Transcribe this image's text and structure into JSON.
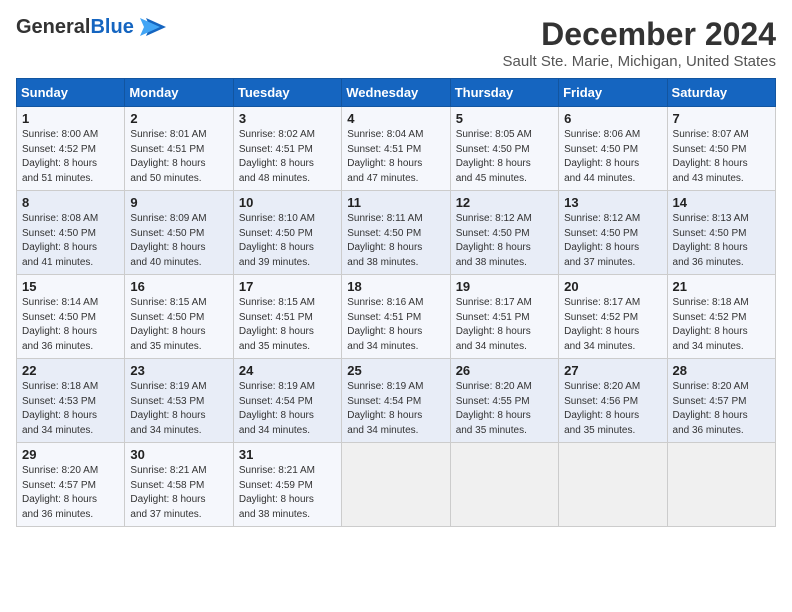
{
  "header": {
    "logo_line1": "General",
    "logo_line2": "Blue",
    "title": "December 2024",
    "subtitle": "Sault Ste. Marie, Michigan, United States"
  },
  "calendar": {
    "weekdays": [
      "Sunday",
      "Monday",
      "Tuesday",
      "Wednesday",
      "Thursday",
      "Friday",
      "Saturday"
    ],
    "weeks": [
      [
        {
          "day": "1",
          "info": "Sunrise: 8:00 AM\nSunset: 4:52 PM\nDaylight: 8 hours\nand 51 minutes."
        },
        {
          "day": "2",
          "info": "Sunrise: 8:01 AM\nSunset: 4:51 PM\nDaylight: 8 hours\nand 50 minutes."
        },
        {
          "day": "3",
          "info": "Sunrise: 8:02 AM\nSunset: 4:51 PM\nDaylight: 8 hours\nand 48 minutes."
        },
        {
          "day": "4",
          "info": "Sunrise: 8:04 AM\nSunset: 4:51 PM\nDaylight: 8 hours\nand 47 minutes."
        },
        {
          "day": "5",
          "info": "Sunrise: 8:05 AM\nSunset: 4:50 PM\nDaylight: 8 hours\nand 45 minutes."
        },
        {
          "day": "6",
          "info": "Sunrise: 8:06 AM\nSunset: 4:50 PM\nDaylight: 8 hours\nand 44 minutes."
        },
        {
          "day": "7",
          "info": "Sunrise: 8:07 AM\nSunset: 4:50 PM\nDaylight: 8 hours\nand 43 minutes."
        }
      ],
      [
        {
          "day": "8",
          "info": "Sunrise: 8:08 AM\nSunset: 4:50 PM\nDaylight: 8 hours\nand 41 minutes."
        },
        {
          "day": "9",
          "info": "Sunrise: 8:09 AM\nSunset: 4:50 PM\nDaylight: 8 hours\nand 40 minutes."
        },
        {
          "day": "10",
          "info": "Sunrise: 8:10 AM\nSunset: 4:50 PM\nDaylight: 8 hours\nand 39 minutes."
        },
        {
          "day": "11",
          "info": "Sunrise: 8:11 AM\nSunset: 4:50 PM\nDaylight: 8 hours\nand 38 minutes."
        },
        {
          "day": "12",
          "info": "Sunrise: 8:12 AM\nSunset: 4:50 PM\nDaylight: 8 hours\nand 38 minutes."
        },
        {
          "day": "13",
          "info": "Sunrise: 8:12 AM\nSunset: 4:50 PM\nDaylight: 8 hours\nand 37 minutes."
        },
        {
          "day": "14",
          "info": "Sunrise: 8:13 AM\nSunset: 4:50 PM\nDaylight: 8 hours\nand 36 minutes."
        }
      ],
      [
        {
          "day": "15",
          "info": "Sunrise: 8:14 AM\nSunset: 4:50 PM\nDaylight: 8 hours\nand 36 minutes."
        },
        {
          "day": "16",
          "info": "Sunrise: 8:15 AM\nSunset: 4:50 PM\nDaylight: 8 hours\nand 35 minutes."
        },
        {
          "day": "17",
          "info": "Sunrise: 8:15 AM\nSunset: 4:51 PM\nDaylight: 8 hours\nand 35 minutes."
        },
        {
          "day": "18",
          "info": "Sunrise: 8:16 AM\nSunset: 4:51 PM\nDaylight: 8 hours\nand 34 minutes."
        },
        {
          "day": "19",
          "info": "Sunrise: 8:17 AM\nSunset: 4:51 PM\nDaylight: 8 hours\nand 34 minutes."
        },
        {
          "day": "20",
          "info": "Sunrise: 8:17 AM\nSunset: 4:52 PM\nDaylight: 8 hours\nand 34 minutes."
        },
        {
          "day": "21",
          "info": "Sunrise: 8:18 AM\nSunset: 4:52 PM\nDaylight: 8 hours\nand 34 minutes."
        }
      ],
      [
        {
          "day": "22",
          "info": "Sunrise: 8:18 AM\nSunset: 4:53 PM\nDaylight: 8 hours\nand 34 minutes."
        },
        {
          "day": "23",
          "info": "Sunrise: 8:19 AM\nSunset: 4:53 PM\nDaylight: 8 hours\nand 34 minutes."
        },
        {
          "day": "24",
          "info": "Sunrise: 8:19 AM\nSunset: 4:54 PM\nDaylight: 8 hours\nand 34 minutes."
        },
        {
          "day": "25",
          "info": "Sunrise: 8:19 AM\nSunset: 4:54 PM\nDaylight: 8 hours\nand 34 minutes."
        },
        {
          "day": "26",
          "info": "Sunrise: 8:20 AM\nSunset: 4:55 PM\nDaylight: 8 hours\nand 35 minutes."
        },
        {
          "day": "27",
          "info": "Sunrise: 8:20 AM\nSunset: 4:56 PM\nDaylight: 8 hours\nand 35 minutes."
        },
        {
          "day": "28",
          "info": "Sunrise: 8:20 AM\nSunset: 4:57 PM\nDaylight: 8 hours\nand 36 minutes."
        }
      ],
      [
        {
          "day": "29",
          "info": "Sunrise: 8:20 AM\nSunset: 4:57 PM\nDaylight: 8 hours\nand 36 minutes."
        },
        {
          "day": "30",
          "info": "Sunrise: 8:21 AM\nSunset: 4:58 PM\nDaylight: 8 hours\nand 37 minutes."
        },
        {
          "day": "31",
          "info": "Sunrise: 8:21 AM\nSunset: 4:59 PM\nDaylight: 8 hours\nand 38 minutes."
        },
        {
          "day": "",
          "info": ""
        },
        {
          "day": "",
          "info": ""
        },
        {
          "day": "",
          "info": ""
        },
        {
          "day": "",
          "info": ""
        }
      ]
    ]
  }
}
